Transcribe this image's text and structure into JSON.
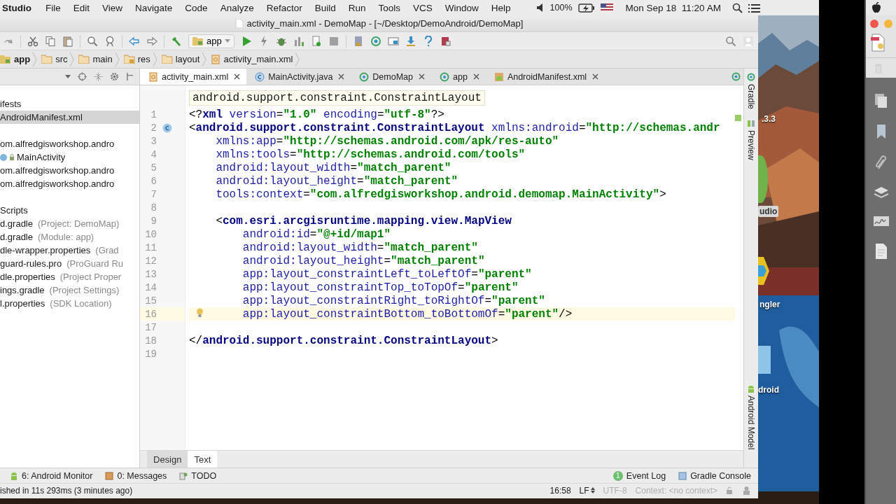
{
  "menu_bar": {
    "app_name": "Studio",
    "menus": [
      "File",
      "Edit",
      "View",
      "Navigate",
      "Code",
      "Analyze",
      "Refactor",
      "Build",
      "Run",
      "Tools",
      "VCS",
      "Window",
      "Help"
    ],
    "battery": "100%",
    "clock": "Mon Sep 18  11:20 AM"
  },
  "window": {
    "title": "activity_main.xml - DemoMap - [~/Desktop/DemoAndroid/DemoMap]"
  },
  "toolbar": {
    "run_config": "app"
  },
  "breadcrumbs": [
    {
      "label": "app",
      "kind": "module"
    },
    {
      "label": "src",
      "kind": "folder"
    },
    {
      "label": "main",
      "kind": "folder"
    },
    {
      "label": "res",
      "kind": "res"
    },
    {
      "label": "layout",
      "kind": "folder"
    },
    {
      "label": "activity_main.xml",
      "kind": "xml"
    }
  ],
  "project_tree": {
    "groups": [
      {
        "rows": [
          {
            "text": "ifests",
            "kind": "item",
            "selected": false
          },
          {
            "text": "AndroidManifest.xml",
            "kind": "item",
            "selected": true
          }
        ]
      },
      {
        "rows": [
          {
            "text": "om.alfredgisworkshop.andro",
            "kind": "item",
            "selected": false
          },
          {
            "text": "MainActivity",
            "kind": "class",
            "selected": false
          },
          {
            "text": "om.alfredgisworkshop.andro",
            "kind": "item",
            "selected": false
          },
          {
            "text": "om.alfredgisworkshop.andro",
            "kind": "item",
            "selected": false
          }
        ]
      },
      {
        "rows": [
          {
            "text": "Scripts",
            "kind": "item",
            "selected": false
          },
          {
            "text": "d.gradle",
            "detail": "(Project: DemoMap)",
            "kind": "item",
            "selected": false
          },
          {
            "text": "d.gradle",
            "detail": "(Module: app)",
            "kind": "item",
            "selected": false
          },
          {
            "text": "dle-wrapper.properties",
            "detail": "(Grad",
            "kind": "item",
            "selected": false
          },
          {
            "text": "guard-rules.pro",
            "detail": "(ProGuard Ru",
            "kind": "item",
            "selected": false
          },
          {
            "text": "dle.properties",
            "detail": "(Project Proper",
            "kind": "item",
            "selected": false
          },
          {
            "text": "ings.gradle",
            "detail": "(Project Settings)",
            "kind": "item",
            "selected": false
          },
          {
            "text": "l.properties",
            "detail": "(SDK Location)",
            "kind": "item",
            "selected": false
          }
        ]
      }
    ]
  },
  "editor_tabs": [
    {
      "label": "activity_main.xml",
      "kind": "xml",
      "selected": true
    },
    {
      "label": "MainActivity.java",
      "kind": "class",
      "selected": false
    },
    {
      "label": "DemoMap",
      "kind": "module",
      "selected": false
    },
    {
      "label": "app",
      "kind": "module",
      "selected": false
    },
    {
      "label": "AndroidManifest.xml",
      "kind": "manifest",
      "selected": false
    }
  ],
  "editor": {
    "breadcrumb_hint": "android.support.constraint.ConstraintLayout",
    "lines": [
      {
        "number": "1",
        "kind": "plain",
        "current": false,
        "tokens": [
          {
            "kind": "punct",
            "text": "<?"
          },
          {
            "kind": "tag",
            "text": "xml"
          },
          {
            "kind": "attr",
            "text": " version"
          },
          {
            "kind": "punct",
            "text": "="
          },
          {
            "kind": "value",
            "text": "\"1.0\""
          },
          {
            "kind": "attr",
            "text": " encoding"
          },
          {
            "kind": "punct",
            "text": "="
          },
          {
            "kind": "value",
            "text": "\"utf-8\""
          },
          {
            "kind": "punct",
            "text": "?>"
          }
        ]
      },
      {
        "number": "2",
        "kind": "class_marker",
        "current": false,
        "tokens": [
          {
            "kind": "punct",
            "text": "<"
          },
          {
            "kind": "tag",
            "text": "android.support.constraint.ConstraintLayout"
          },
          {
            "kind": "attr",
            "text": " xmlns:android"
          },
          {
            "kind": "punct",
            "text": "="
          },
          {
            "kind": "value",
            "text": "\"http://schemas.andr"
          }
        ]
      },
      {
        "number": "3",
        "kind": "plain",
        "current": false,
        "tokens": [
          {
            "kind": "attr",
            "text": "    xmlns:app"
          },
          {
            "kind": "punct",
            "text": "="
          },
          {
            "kind": "value",
            "text": "\"http://schemas.android.com/apk/res-auto\""
          }
        ]
      },
      {
        "number": "4",
        "kind": "plain",
        "current": false,
        "tokens": [
          {
            "kind": "attr",
            "text": "    xmlns:tools"
          },
          {
            "kind": "punct",
            "text": "="
          },
          {
            "kind": "value",
            "text": "\"http://schemas.android.com/tools\""
          }
        ]
      },
      {
        "number": "5",
        "kind": "plain",
        "current": false,
        "tokens": [
          {
            "kind": "attr",
            "text": "    android:layout_width"
          },
          {
            "kind": "punct",
            "text": "="
          },
          {
            "kind": "value",
            "text": "\"match_parent\""
          }
        ]
      },
      {
        "number": "6",
        "kind": "plain",
        "current": false,
        "tokens": [
          {
            "kind": "attr",
            "text": "    android:layout_height"
          },
          {
            "kind": "punct",
            "text": "="
          },
          {
            "kind": "value",
            "text": "\"match_parent\""
          }
        ]
      },
      {
        "number": "7",
        "kind": "plain",
        "current": false,
        "tokens": [
          {
            "kind": "attr",
            "text": "    tools:context"
          },
          {
            "kind": "punct",
            "text": "="
          },
          {
            "kind": "value",
            "text": "\"com.alfredgisworkshop.android.demomap.MainActivity\""
          },
          {
            "kind": "punct",
            "text": ">"
          }
        ]
      },
      {
        "number": "8",
        "kind": "plain",
        "current": false
      },
      {
        "number": "9",
        "kind": "plain",
        "current": false,
        "tokens": [
          {
            "kind": "punct",
            "text": "    <"
          },
          {
            "kind": "tag",
            "text": "com.esri.arcgisruntime.mapping.view.MapView"
          }
        ]
      },
      {
        "number": "10",
        "kind": "plain",
        "current": false,
        "tokens": [
          {
            "kind": "attr",
            "text": "        android:id"
          },
          {
            "kind": "punct",
            "text": "="
          },
          {
            "kind": "value",
            "text": "\"@+id/map1\""
          }
        ]
      },
      {
        "number": "11",
        "kind": "plain",
        "current": false,
        "tokens": [
          {
            "kind": "attr",
            "text": "        android:layout_width"
          },
          {
            "kind": "punct",
            "text": "="
          },
          {
            "kind": "value",
            "text": "\"match_parent\""
          }
        ]
      },
      {
        "number": "12",
        "kind": "plain",
        "current": false,
        "tokens": [
          {
            "kind": "attr",
            "text": "        android:layout_height"
          },
          {
            "kind": "punct",
            "text": "="
          },
          {
            "kind": "value",
            "text": "\"match_parent\""
          }
        ]
      },
      {
        "number": "13",
        "kind": "plain",
        "current": false,
        "tokens": [
          {
            "kind": "attr",
            "text": "        app:layout_constraintLeft_toLeftOf"
          },
          {
            "kind": "punct",
            "text": "="
          },
          {
            "kind": "value",
            "text": "\"parent\""
          }
        ]
      },
      {
        "number": "14",
        "kind": "plain",
        "current": false,
        "tokens": [
          {
            "kind": "attr",
            "text": "        app:layout_constraintTop_toTopOf"
          },
          {
            "kind": "punct",
            "text": "="
          },
          {
            "kind": "value",
            "text": "\"parent\""
          }
        ]
      },
      {
        "number": "15",
        "kind": "plain",
        "current": false,
        "tokens": [
          {
            "kind": "attr",
            "text": "        app:layout_constraintRight_toRightOf"
          },
          {
            "kind": "punct",
            "text": "="
          },
          {
            "kind": "value",
            "text": "\"parent\""
          }
        ]
      },
      {
        "number": "16",
        "kind": "bulb",
        "current": true,
        "tokens": [
          {
            "kind": "attr",
            "text": "        app:layout_constraintBottom_toBottomOf"
          },
          {
            "kind": "punct",
            "text": "="
          },
          {
            "kind": "value",
            "text": "\"parent\""
          },
          {
            "kind": "punct",
            "text": "/>"
          }
        ]
      },
      {
        "number": "17",
        "kind": "plain",
        "current": false
      },
      {
        "number": "18",
        "kind": "plain",
        "current": false,
        "tokens": [
          {
            "kind": "punct",
            "text": "</"
          },
          {
            "kind": "tag",
            "text": "android.support.constraint.ConstraintLayout"
          },
          {
            "kind": "punct",
            "text": ">"
          }
        ]
      },
      {
        "number": "19",
        "kind": "plain",
        "current": false
      }
    ]
  },
  "right_tool_tabs": {
    "top": [
      {
        "label": "Gradle",
        "kind": "gradle"
      },
      {
        "label": "Preview",
        "kind": "preview"
      }
    ],
    "bottom": [
      {
        "label": "Android Model",
        "kind": "android"
      }
    ]
  },
  "editor_mode_tabs": [
    {
      "label": "Design",
      "selected": false
    },
    {
      "label": "Text",
      "selected": true
    }
  ],
  "tool_windows": {
    "left": [
      {
        "label": "6: Android Monitor",
        "kind": "android"
      },
      {
        "label": "0: Messages",
        "kind": "messages"
      },
      {
        "label": "TODO",
        "kind": "todo"
      }
    ],
    "right": [
      {
        "label": "Event Log",
        "kind": "event_log",
        "badge": "1"
      },
      {
        "label": "Gradle Console",
        "kind": "console"
      }
    ]
  },
  "status_bar": {
    "message": "ished in 11s 293ms (3 minutes ago)",
    "position": "16:58",
    "line_separator": "LF",
    "encoding": "UTF-8",
    "context": "Context: <no context>"
  },
  "desktop_labels": [
    ".3.3",
    "udio",
    "ngler",
    "droid"
  ]
}
